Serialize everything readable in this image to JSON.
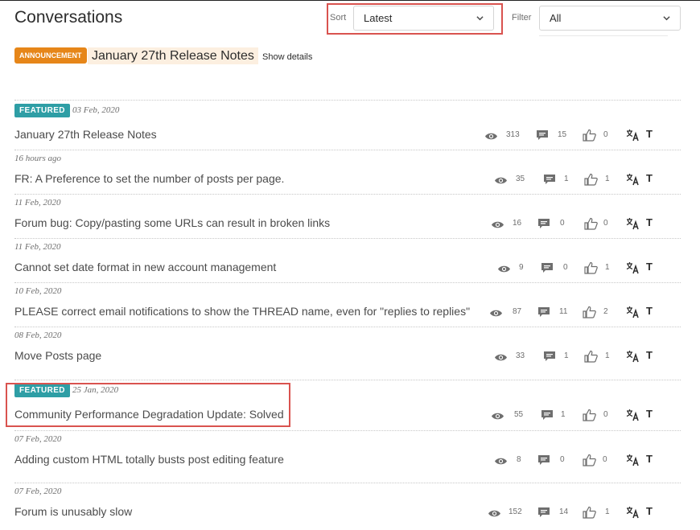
{
  "header": {
    "title": "Conversations",
    "sort_label": "Sort",
    "sort_value": "Latest",
    "filter_label": "Filter",
    "filter_value": "All"
  },
  "announcement": {
    "badge": "ANNOUNCEMENT",
    "title": "January 27th Release Notes",
    "show_details": "Show details"
  },
  "featured_label": "FEATURED",
  "translate_letter": "T",
  "colors": {
    "announcement": "#e68619",
    "featured": "#2e9ea5",
    "highlight": "#d9534f"
  },
  "posts": [
    {
      "featured": true,
      "date": "03 Feb, 2020",
      "title": "January 27th Release Notes",
      "views": "313",
      "replies": "15",
      "likes": "0"
    },
    {
      "featured": false,
      "date": "16 hours ago",
      "title": "FR: A Preference to set the number of posts per page.",
      "views": "35",
      "replies": "1",
      "likes": "1"
    },
    {
      "featured": false,
      "date": "11 Feb, 2020",
      "title": "Forum bug: Copy/pasting some URLs can result in broken links",
      "views": "16",
      "replies": "0",
      "likes": "0"
    },
    {
      "featured": false,
      "date": "11 Feb, 2020",
      "title": "Cannot set date format in new account management",
      "views": "9",
      "replies": "0",
      "likes": "1"
    },
    {
      "featured": false,
      "date": "10 Feb, 2020",
      "title": "PLEASE correct email notifications to show the THREAD name, even for \"replies to replies\"",
      "views": "87",
      "replies": "11",
      "likes": "2"
    },
    {
      "featured": false,
      "date": "08 Feb, 2020",
      "title": "Move Posts page",
      "views": "33",
      "replies": "1",
      "likes": "1"
    },
    {
      "featured": true,
      "date": "25 Jan, 2020",
      "title": "Community Performance Degradation Update: Solved",
      "views": "55",
      "replies": "1",
      "likes": "0"
    },
    {
      "featured": false,
      "date": "07 Feb, 2020",
      "title": "Adding custom HTML totally busts post editing feature",
      "views": "8",
      "replies": "0",
      "likes": "0"
    },
    {
      "featured": false,
      "date": "07 Feb, 2020",
      "title": "Forum is unusably slow",
      "views": "152",
      "replies": "14",
      "likes": "1"
    }
  ]
}
